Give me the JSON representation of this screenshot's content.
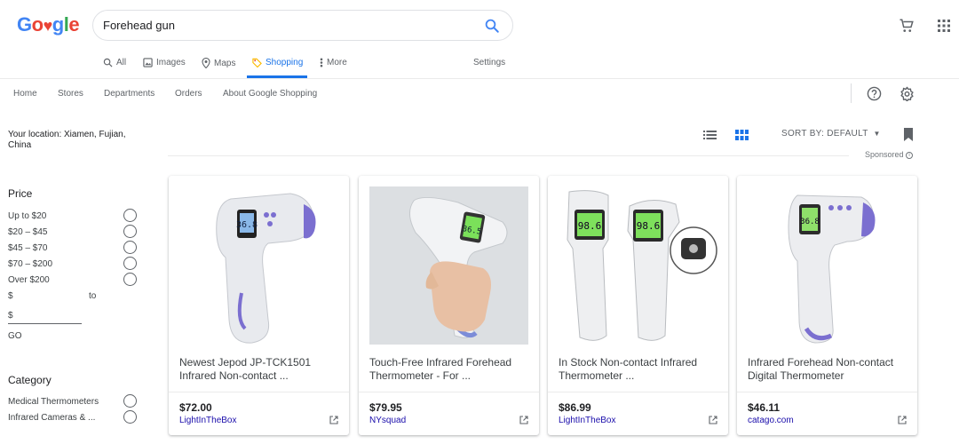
{
  "logo": {
    "text": "Google"
  },
  "search": {
    "query": "Forehead gun"
  },
  "tabs": [
    {
      "label": "All",
      "icon": "search-icon"
    },
    {
      "label": "Images",
      "icon": "image-icon"
    },
    {
      "label": "Maps",
      "icon": "map-pin-icon"
    },
    {
      "label": "Shopping",
      "icon": "tag-icon",
      "active": true
    },
    {
      "label": "More",
      "icon": "more-vert-icon"
    }
  ],
  "settings_label": "Settings",
  "subnav": [
    "Home",
    "Stores",
    "Departments",
    "Orders",
    "About Google Shopping"
  ],
  "sidebar": {
    "location": "Your location: Xiamen, Fujian, China",
    "price_title": "Price",
    "price_options": [
      "Up to $20",
      "$20 – $45",
      "$45 – $70",
      "$70 – $200",
      "Over $200"
    ],
    "range_from_symbol": "$",
    "range_to_label": "to",
    "range_to_symbol": "$",
    "go_label": "GO",
    "category_title": "Category",
    "category_options": [
      "Medical Thermometers",
      "Infrared Cameras & ..."
    ]
  },
  "toolbar": {
    "sort_label": "SORT BY: DEFAULT",
    "sponsored_label": "Sponsored"
  },
  "colors": {
    "accent": "#1a73e8",
    "store_link": "#1a0dab"
  },
  "products": [
    {
      "title": "Newest Jepod JP-TCK1501 Infrared Non-contact ...",
      "price": "$72.00",
      "store": "LightInTheBox"
    },
    {
      "title": "Touch-Free Infrared Forehead Thermometer - For ...",
      "price": "$79.95",
      "store": "NYsquad"
    },
    {
      "title": "In Stock Non-contact Infrared Thermometer ...",
      "price": "$86.99",
      "store": "LightInTheBox"
    },
    {
      "title": "Infrared Forehead Non-contact Digital Thermometer",
      "price": "$46.11",
      "store": "catago.com"
    }
  ],
  "thermometer_readings": [
    "36.8",
    "36.5",
    "98.6",
    "98.6",
    "36.8"
  ]
}
